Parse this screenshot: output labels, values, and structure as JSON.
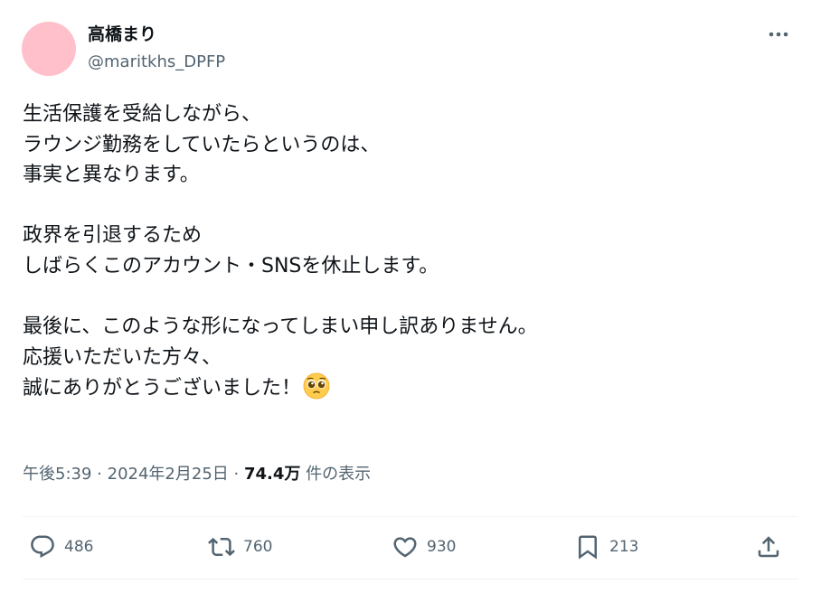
{
  "user": {
    "display_name": "高橋まり",
    "handle": "@maritkhs_DPFP",
    "avatar_color": "#ffc0cb"
  },
  "tweet": {
    "text": "生活保護を受給しながら、\nラウンジ勤務をしていたらというのは、\n事実と異なります。\n\n政界を引退するため\nしばらくこのアカウント・SNSを休止します。\n\n最後に、このような形になってしまい申し訳ありません。\n応援いただいた方々、\n誠にありがとうございました！",
    "emoji_icon": "pleading-face"
  },
  "meta": {
    "time": "午後5:39",
    "separator": "·",
    "date": "2024年2月25日",
    "views_count": "74.4万",
    "views_label": "件の表示"
  },
  "actions": {
    "replies": "486",
    "retweets": "760",
    "likes": "930",
    "bookmarks": "213"
  },
  "colors": {
    "text": "#0f1419",
    "secondary": "#536471",
    "divider": "#eff3f4"
  }
}
